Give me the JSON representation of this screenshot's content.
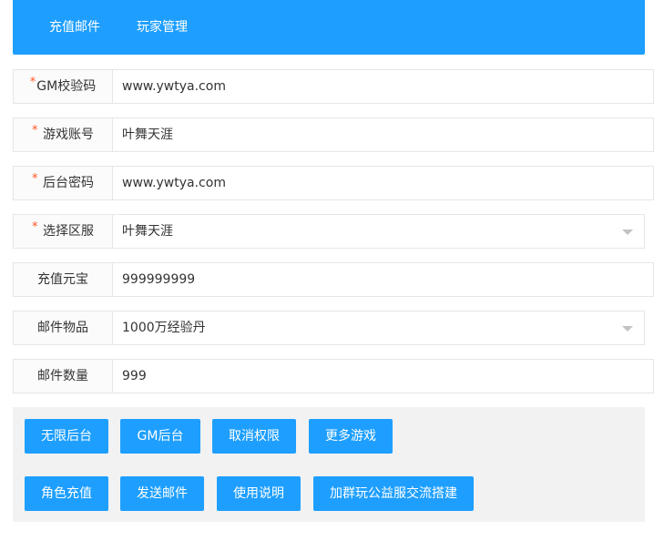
{
  "nav": {
    "items": [
      {
        "label": "充值邮件"
      },
      {
        "label": "玩家管理"
      }
    ]
  },
  "form": {
    "required_mark": "*",
    "fields": [
      {
        "label": "GM校验码",
        "value": "www.ywtya.com",
        "required": true,
        "type": "text"
      },
      {
        "label": "游戏账号",
        "value": "叶舞天涯",
        "required": true,
        "type": "text"
      },
      {
        "label": "后台密码",
        "value": "www.ywtya.com",
        "required": true,
        "type": "text"
      },
      {
        "label": "选择区服",
        "value": "叶舞天涯",
        "required": true,
        "type": "select"
      },
      {
        "label": "充值元宝",
        "value": "999999999",
        "required": false,
        "type": "text"
      },
      {
        "label": "邮件物品",
        "value": "1000万经验丹",
        "required": false,
        "type": "select"
      },
      {
        "label": "邮件数量",
        "value": "999",
        "required": false,
        "type": "text"
      }
    ]
  },
  "buttons": {
    "row1": [
      {
        "label": "无限后台"
      },
      {
        "label": "GM后台"
      },
      {
        "label": "取消权限"
      },
      {
        "label": "更多游戏"
      }
    ],
    "row2": [
      {
        "label": "角色充值"
      },
      {
        "label": "发送邮件"
      },
      {
        "label": "使用说明"
      },
      {
        "label": "加群玩公益服交流搭建"
      }
    ]
  },
  "colors": {
    "accent": "#1e9fff",
    "required": "#ff5722",
    "panel_bg": "#f2f2f2"
  }
}
